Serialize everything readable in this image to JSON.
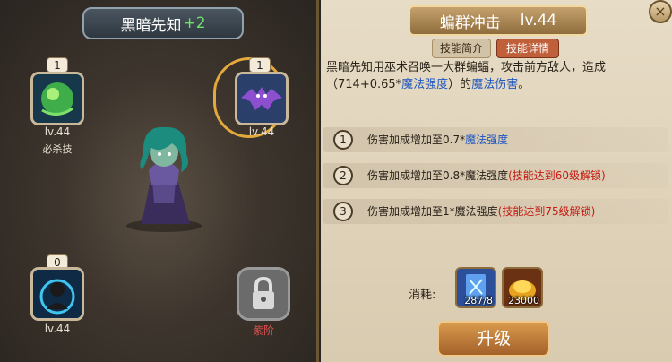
{
  "hero": {
    "name": "黑暗先知",
    "plus": "+2"
  },
  "skills": [
    {
      "level_badge": "1",
      "lv": "lv.44",
      "sub": "必杀技",
      "icon": "green-orb-icon"
    },
    {
      "level_badge": "1",
      "lv": "lv.44",
      "sub": "",
      "icon": "bat-swarm-icon"
    },
    {
      "level_badge": "0",
      "lv": "lv.44",
      "sub": "",
      "icon": "blue-sigil-icon"
    },
    {
      "level_badge": "",
      "lv": "",
      "sub": "紫阶",
      "icon": "lock-icon"
    }
  ],
  "detail": {
    "skill_name": "蝙群冲击",
    "skill_level": "lv.44",
    "close": "×",
    "tabs": {
      "intro": "技能简介",
      "detail": "技能详情"
    },
    "desc_before": "黑暗先知用巫术召唤一大群蝙蝠，攻击前方敌人，造成（714+0.65*",
    "desc_stat": "魔法强度",
    "desc_mid": "）的",
    "desc_dmg": "魔法伤害",
    "desc_end": "。",
    "upgrades": [
      {
        "num": "1",
        "text": "伤害加成增加至0.7*",
        "stat": "魔法强度",
        "lock": ""
      },
      {
        "num": "2",
        "text": "伤害加成增加至0.8*魔法强度",
        "stat": "",
        "lock": "(技能达到60级解锁)"
      },
      {
        "num": "3",
        "text": "伤害加成增加至1*魔法强度",
        "stat": "",
        "lock": "(技能达到75级解锁)"
      }
    ],
    "cost_label": "消耗:",
    "costs": [
      {
        "qty": "287/8",
        "icon": "skill-book-icon"
      },
      {
        "qty": "23000",
        "icon": "gold-icon"
      }
    ],
    "upgrade_label": "升级"
  }
}
